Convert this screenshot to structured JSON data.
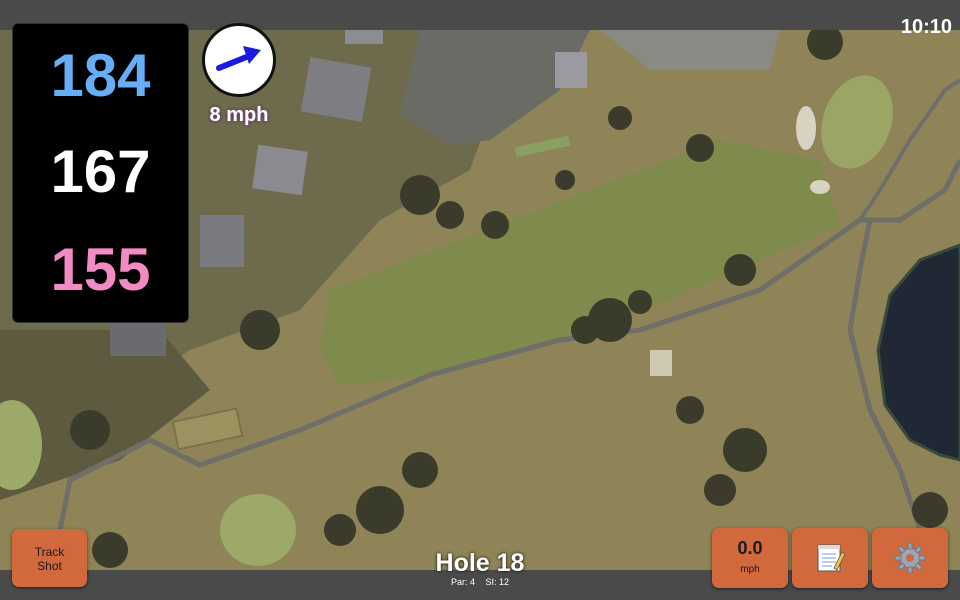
{
  "status": {
    "clock": "10:10"
  },
  "distances": {
    "back": {
      "value": "184",
      "color": "#66aef5"
    },
    "middle": {
      "value": "167",
      "color": "#ffffff"
    },
    "front": {
      "value": "155",
      "color": "#f28ac4"
    }
  },
  "wind": {
    "speed_label": "8 mph",
    "direction_icon": "arrow-icon",
    "arrow_color": "#1a1ae0",
    "label_color": "#e070e0"
  },
  "buttons": {
    "track_shot": {
      "line1": "Track",
      "line2": "Shot"
    },
    "speed": {
      "value": "0.0",
      "unit": "mph"
    },
    "notes_icon": "notepad-icon",
    "settings_icon": "gear-icon",
    "color": "#d2693d"
  },
  "hole": {
    "title": "Hole 18",
    "par": "Par: 4",
    "si": "SI: 12"
  }
}
